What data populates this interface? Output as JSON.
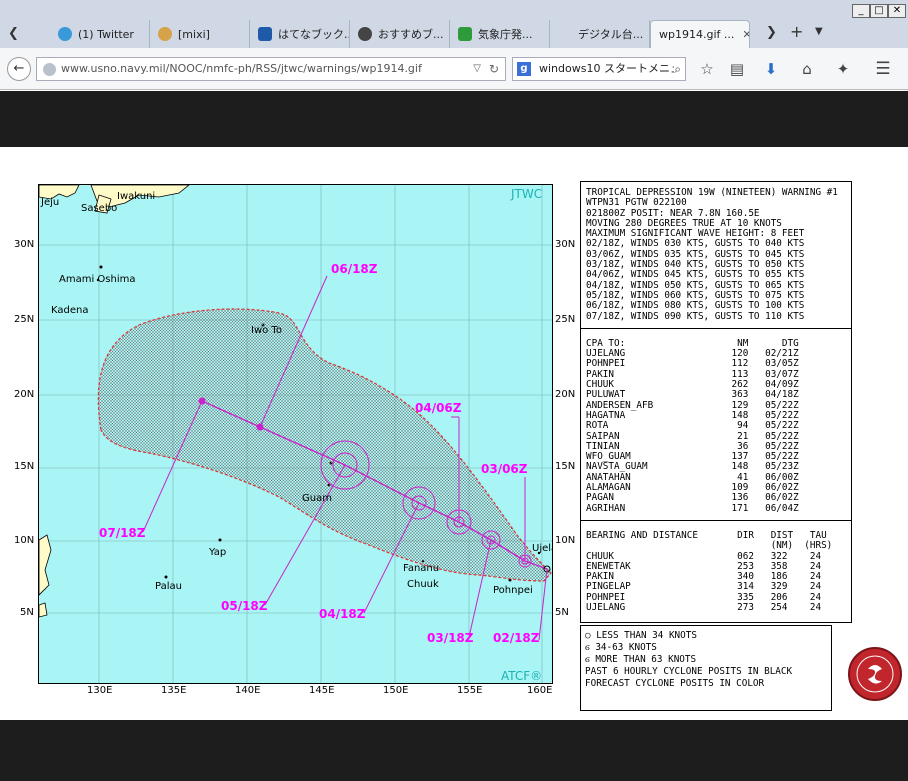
{
  "browser": {
    "tabs": [
      {
        "label": "(1) Twitter",
        "icon": "twitter-bird-icon",
        "color": "#3a9ad9"
      },
      {
        "label": "[mixi]",
        "icon": "mixi-icon",
        "color": "#d6a24a"
      },
      {
        "label": "はてなブック...",
        "icon": "hatena-bookmark-icon",
        "color": "#1e5aa8"
      },
      {
        "label": "おすすめブ...",
        "icon": "recommend-icon",
        "color": "#444444"
      },
      {
        "label": "気象庁発...",
        "icon": "jma-icon",
        "color": "#2e9b3a"
      },
      {
        "label": "デジタル台...",
        "icon": "blank-page-icon",
        "color": ""
      },
      {
        "label": "wp1914.gif ...",
        "icon": "blank-page-icon",
        "color": ""
      }
    ],
    "url": "www.usno.navy.mil/NOOC/nmfc-ph/RSS/jtwc/warnings/wp1914.gif",
    "search_engine": "g",
    "search_text": "windows10 スタートメニュ"
  },
  "map": {
    "tag_top": "JTWC",
    "tag_bottom": "ATCF®",
    "lat_labels": [
      "30N",
      "25N",
      "20N",
      "15N",
      "10N",
      "5N"
    ],
    "lon_labels": [
      "130E",
      "135E",
      "140E",
      "145E",
      "150E",
      "155E",
      "160E"
    ],
    "places": {
      "jeju": "Jeju",
      "sasebo": "Sasebo",
      "iwakuni": "Iwakuni",
      "amami": "Amami Oshima",
      "kadena": "Kadena",
      "iwoto": "Iwo To",
      "guam": "Guam",
      "yap": "Yap",
      "palau": "Palau",
      "fananu": "Fananu",
      "chuuk": "Chuuk",
      "pohnpei": "Pohnpei",
      "ujela": "Ujela"
    },
    "track_labels": [
      "06/18Z",
      "04/06Z",
      "03/06Z",
      "07/18Z",
      "05/18Z",
      "04/18Z",
      "03/18Z",
      "02/18Z"
    ]
  },
  "warning": {
    "header": [
      "TROPICAL DEPRESSION 19W (NINETEEN) WARNING #1",
      "WTPN31 PGTW 022100",
      "021800Z POSIT: NEAR 7.8N 160.5E",
      "MOVING 280 DEGREES TRUE AT 10 KNOTS",
      "MAXIMUM SIGNIFICANT WAVE HEIGHT: 8 FEET",
      "02/18Z, WINDS 030 KTS, GUSTS TO 040 KTS",
      "03/06Z, WINDS 035 KTS, GUSTS TO 045 KTS",
      "03/18Z, WINDS 040 KTS, GUSTS TO 050 KTS",
      "04/06Z, WINDS 045 KTS, GUSTS TO 055 KTS",
      "04/18Z, WINDS 050 KTS, GUSTS TO 065 KTS",
      "05/18Z, WINDS 060 KTS, GUSTS TO 075 KTS",
      "06/18Z, WINDS 080 KTS, GUSTS TO 100 KTS",
      "07/18Z, WINDS 090 KTS, GUSTS TO 110 KTS"
    ],
    "cpa_header": "CPA TO:                    NM      DTG",
    "cpa_rows": [
      "UJELANG                   120   02/21Z",
      "POHNPEI                   112   03/05Z",
      "PAKIN                     113   03/07Z",
      "CHUUK                     262   04/09Z",
      "PULUWAT                   363   04/18Z",
      "ANDERSEN_AFB              129   05/22Z",
      "HAGATNA                   148   05/22Z",
      "ROTA                       94   05/22Z",
      "SAIPAN                     21   05/22Z",
      "TINIAN                     36   05/22Z",
      "WFO_GUAM                  137   05/22Z",
      "NAVSTA_GUAM               148   05/23Z",
      "ANATAHAN                   41   06/00Z",
      "ALAMAGAN                  109   06/02Z",
      "PAGAN                     136   06/02Z",
      "AGRIHAN                   171   06/04Z"
    ],
    "bd_header": "BEARING AND DISTANCE       DIR   DIST   TAU",
    "bd_header2": "                                 (NM)  (HRS)",
    "bd_rows": [
      "CHUUK                      062   322    24",
      "ENEWETAK                   253   358    24",
      "PAKIN                      340   186    24",
      "PINGELAP                   314   329    24",
      "POHNPEI                    335   206    24",
      "UJELANG                    273   254    24"
    ]
  },
  "legend": {
    "rows": [
      "○ LESS THAN 34 KNOTS",
      "ϭ 34-63 KNOTS",
      "ϭ MORE THAN 63 KNOTS",
      "PAST 6 HOURLY CYCLONE POSITS IN BLACK",
      "FORECAST CYCLONE POSITS IN COLOR"
    ]
  }
}
